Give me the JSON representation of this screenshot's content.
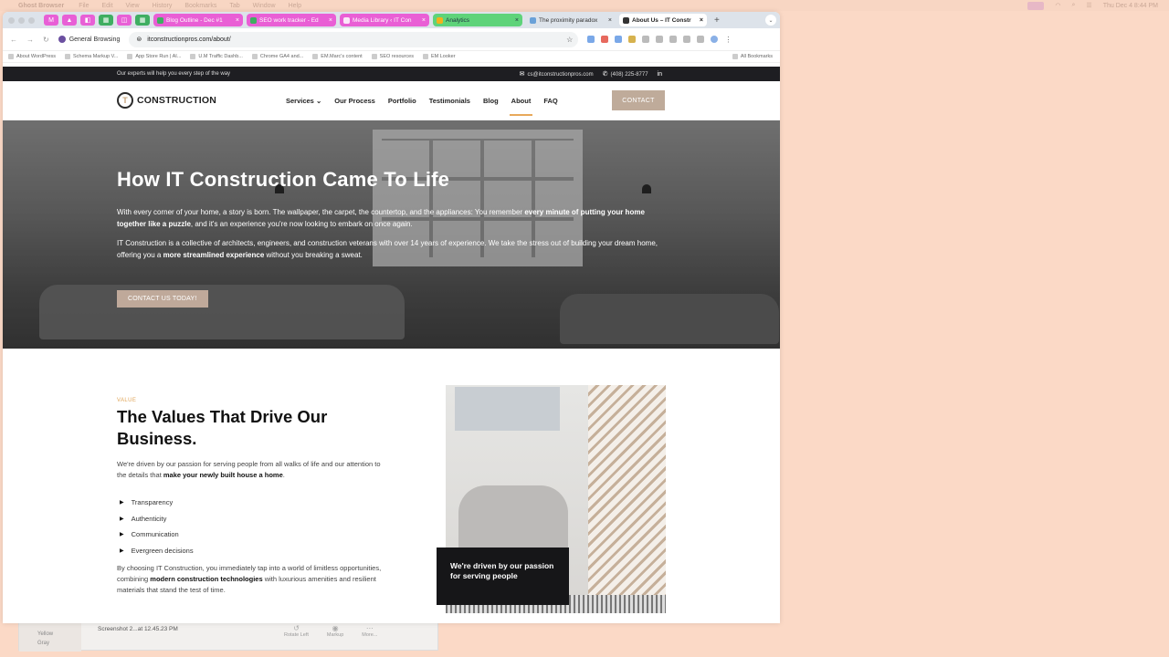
{
  "menubar": {
    "app": "Ghost Browser",
    "items": [
      "File",
      "Edit",
      "View",
      "History",
      "Bookmarks",
      "Tab",
      "Window",
      "Help"
    ],
    "clock": "Thu Dec 4  8:44 PM"
  },
  "tabs": [
    {
      "title": "Blog Outline - Dec #1",
      "style": "pink"
    },
    {
      "title": "SEO work tracker - Ed",
      "style": "pink"
    },
    {
      "title": "Media Library ‹ IT Con",
      "style": "pink"
    },
    {
      "title": "Analytics",
      "style": "green"
    },
    {
      "title": "The proximity paradox",
      "style": "plain"
    },
    {
      "title": "About Us – IT Constr",
      "style": "active"
    }
  ],
  "toolbar": {
    "profile": "General Browsing",
    "url": "itconstructionpros.com/about/"
  },
  "bookmarks": {
    "items": [
      "About WordPress",
      "Schema Markup V...",
      "App Store Run | AI...",
      "U.M Traffic Dashb...",
      "Chrome GA4 and...",
      "EM.Marc's content",
      "SEO resources",
      "EM Looker"
    ],
    "all": "All Bookmarks"
  },
  "site": {
    "tagline": "Our experts will help you every step of the way",
    "email": "cs@itconstructionpros.com",
    "phone": "(408) 225-8777",
    "logo": "CONSTRUCTION",
    "nav": [
      "Services",
      "Our Process",
      "Portfolio",
      "Testimonials",
      "Blog",
      "About",
      "FAQ"
    ],
    "nav_active": "About",
    "contact_btn": "CONTACT"
  },
  "hero": {
    "title": "How IT Construction Came To Life",
    "p1_a": "With every corner of your home, a story is born. The wallpaper, the carpet, the countertop, and the appliances: You remember ",
    "p1_b": "every minute of putting your home together like a puzzle",
    "p1_c": ", and it's an experience you're now looking to embark on once again.",
    "p2_a": "IT Construction is a collective of architects, engineers, and construction veterans with over 14 years of experience. We take the stress out of building your dream home, offering you a ",
    "p2_b": "more streamlined experience",
    "p2_c": " without you breaking a sweat.",
    "cta": "CONTACT US TODAY!"
  },
  "values": {
    "eyebrow": "VALUE",
    "title": "The Values That Drive Our Business.",
    "desc_a": "We're driven by our passion for serving people from all walks of life and our attention to the details that ",
    "desc_b": "make your newly built house a home",
    "desc_c": ".",
    "list": [
      "Transparency",
      "Authenticity",
      "Communication",
      "Evergreen decisions"
    ],
    "close_a": "By choosing IT Construction, you immediately tap into a world of limitless opportunities, combining ",
    "close_b": "modern construction technologies",
    "close_c": " with luxurious amenities and resilient materials that stand the test of time.",
    "caption": "We're driven by our passion for serving people"
  },
  "preview": {
    "tags": [
      "Yellow",
      "Gray"
    ],
    "file": "Screenshot 2...at 12.45.23 PM",
    "tools": [
      "Rotate Left",
      "Markup",
      "More..."
    ]
  }
}
